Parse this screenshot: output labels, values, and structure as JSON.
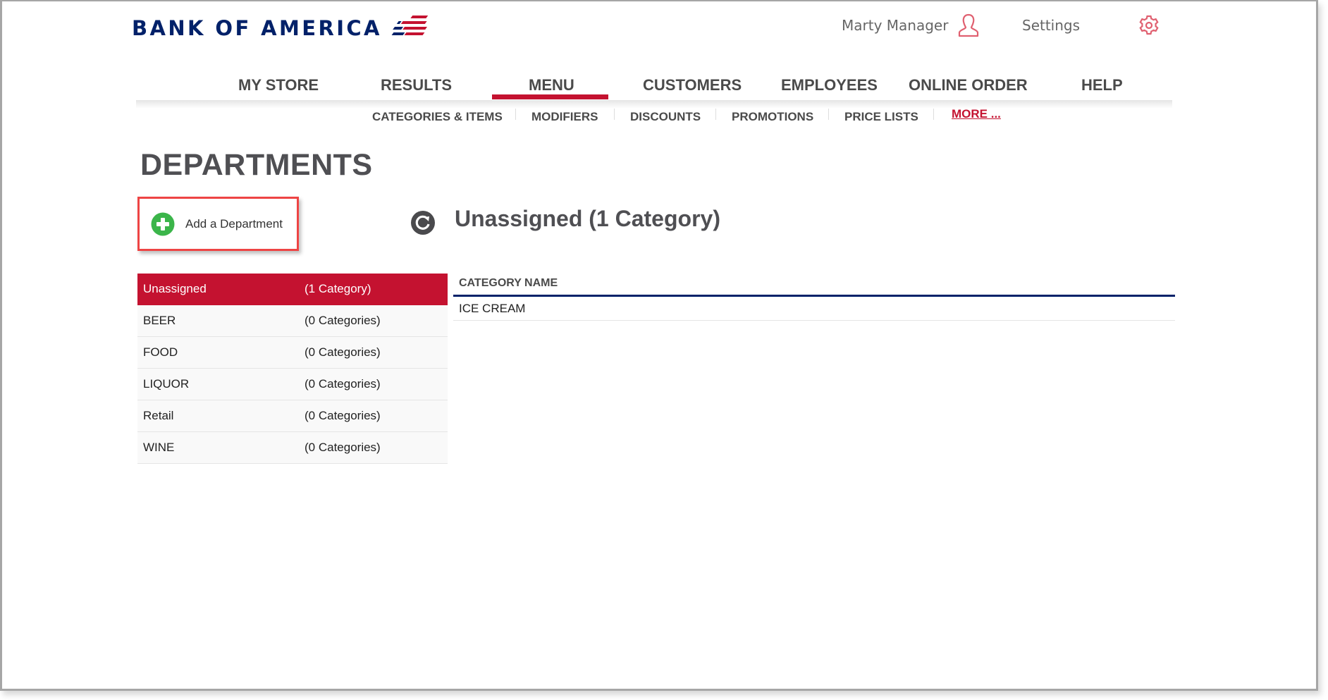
{
  "brand": {
    "name": "BANK OF AMERICA",
    "colors": {
      "navy": "#012169",
      "red": "#c41230",
      "accent_outline": "#ee4444",
      "add_green": "#3bb54a"
    }
  },
  "header": {
    "user_name": "Marty Manager",
    "user_icon": "user-icon",
    "settings_label": "Settings",
    "settings_icon": "gear-icon"
  },
  "main_nav": {
    "items": [
      {
        "label": "MY STORE",
        "active": false
      },
      {
        "label": "RESULTS",
        "active": false
      },
      {
        "label": "MENU",
        "active": true
      },
      {
        "label": "CUSTOMERS",
        "active": false
      },
      {
        "label": "EMPLOYEES",
        "active": false
      },
      {
        "label": "ONLINE ORDER",
        "active": false
      },
      {
        "label": "HELP",
        "active": false
      }
    ]
  },
  "sub_nav": {
    "items": [
      {
        "label": "CATEGORIES & ITEMS"
      },
      {
        "label": "MODIFIERS"
      },
      {
        "label": "DISCOUNTS"
      },
      {
        "label": "PROMOTIONS"
      },
      {
        "label": "PRICE LISTS"
      },
      {
        "label": "MORE ..."
      }
    ]
  },
  "page": {
    "title": "DEPARTMENTS",
    "add_button_label": "Add a Department",
    "add_icon": "plus-circle-icon",
    "refresh_icon": "refresh-icon"
  },
  "departments": [
    {
      "name": "Unassigned",
      "count": "(1 Category)",
      "selected": true
    },
    {
      "name": "BEER",
      "count": "(0 Categories)",
      "selected": false
    },
    {
      "name": "FOOD",
      "count": "(0 Categories)",
      "selected": false
    },
    {
      "name": "LIQUOR",
      "count": "(0 Categories)",
      "selected": false
    },
    {
      "name": "Retail",
      "count": "(0 Categories)",
      "selected": false
    },
    {
      "name": "WINE",
      "count": "(0 Categories)",
      "selected": false
    }
  ],
  "detail": {
    "title": "Unassigned (1 Category)",
    "column_header": "CATEGORY NAME",
    "rows": [
      "ICE CREAM"
    ]
  }
}
